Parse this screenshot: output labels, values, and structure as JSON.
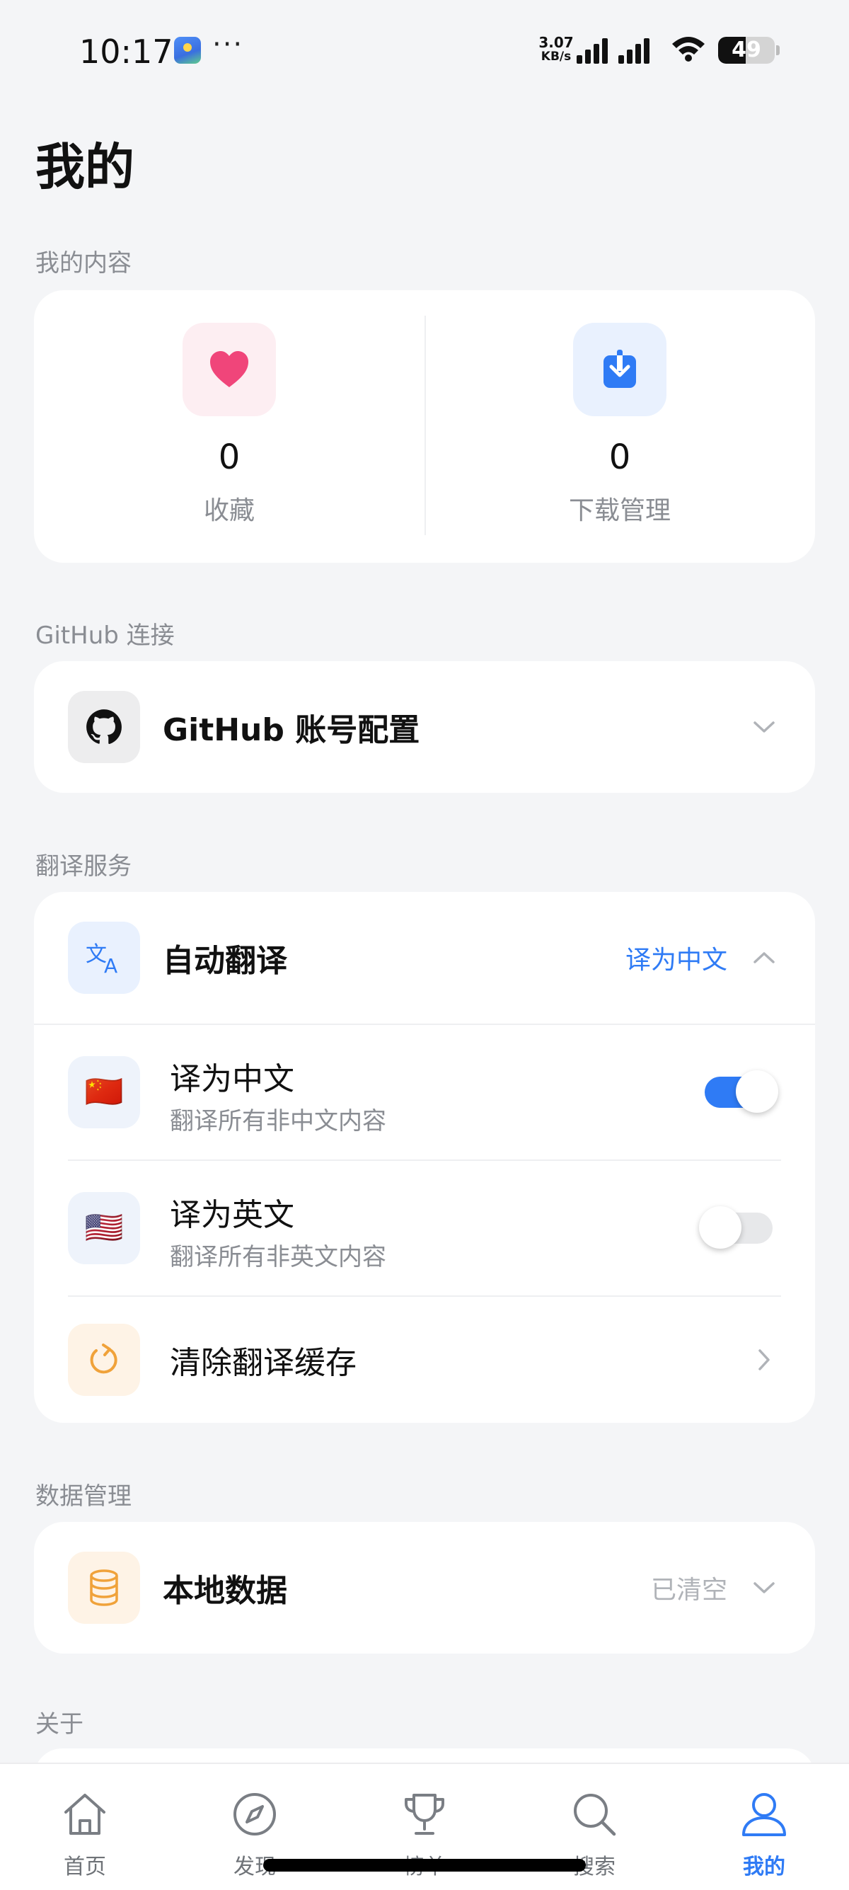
{
  "status_bar": {
    "time": "10:17",
    "more": "···",
    "net_speed_value": "3.07",
    "net_speed_unit": "KB/s",
    "battery_level": "49",
    "battery_fraction": 0.49
  },
  "page_title": "我的",
  "my_content": {
    "section_label": "我的内容",
    "favorites": {
      "value": "0",
      "label": "收藏",
      "icon": "heart-icon",
      "icon_color": "#f0457a",
      "bg_color": "#fdeef2"
    },
    "downloads": {
      "value": "0",
      "label": "下载管理",
      "icon": "download-icon",
      "icon_color": "#2f7bf5",
      "bg_color": "#e9f1fe"
    }
  },
  "github": {
    "section_label": "GitHub 连接",
    "account_config": {
      "title": "GitHub 账号配置",
      "icon": "github-icon"
    }
  },
  "translation": {
    "section_label": "翻译服务",
    "auto_translate": {
      "title": "自动翻译",
      "value": "译为中文",
      "icon": "translate-icon"
    },
    "to_chinese": {
      "title": "译为中文",
      "subtitle": "翻译所有非中文内容",
      "flag": "🇨🇳",
      "enabled": true
    },
    "to_english": {
      "title": "译为英文",
      "subtitle": "翻译所有非英文内容",
      "flag": "🇺🇸",
      "enabled": false
    },
    "clear_cache": {
      "title": "清除翻译缓存",
      "icon": "refresh-icon"
    }
  },
  "data_management": {
    "section_label": "数据管理",
    "local_data": {
      "title": "本地数据",
      "value": "已清空",
      "icon": "database-icon"
    }
  },
  "about": {
    "section_label": "关于"
  },
  "bottom_nav": {
    "items": [
      {
        "label": "首页",
        "icon": "home-icon"
      },
      {
        "label": "发现",
        "icon": "compass-icon"
      },
      {
        "label": "榜单",
        "icon": "trophy-icon"
      },
      {
        "label": "搜索",
        "icon": "search-icon"
      },
      {
        "label": "我的",
        "icon": "user-icon"
      }
    ],
    "active_index": 4
  },
  "colors": {
    "accent": "#2f7bf5",
    "orange": "#f0a23a",
    "muted_text": "#8a8d93",
    "background": "#f4f5f7"
  }
}
